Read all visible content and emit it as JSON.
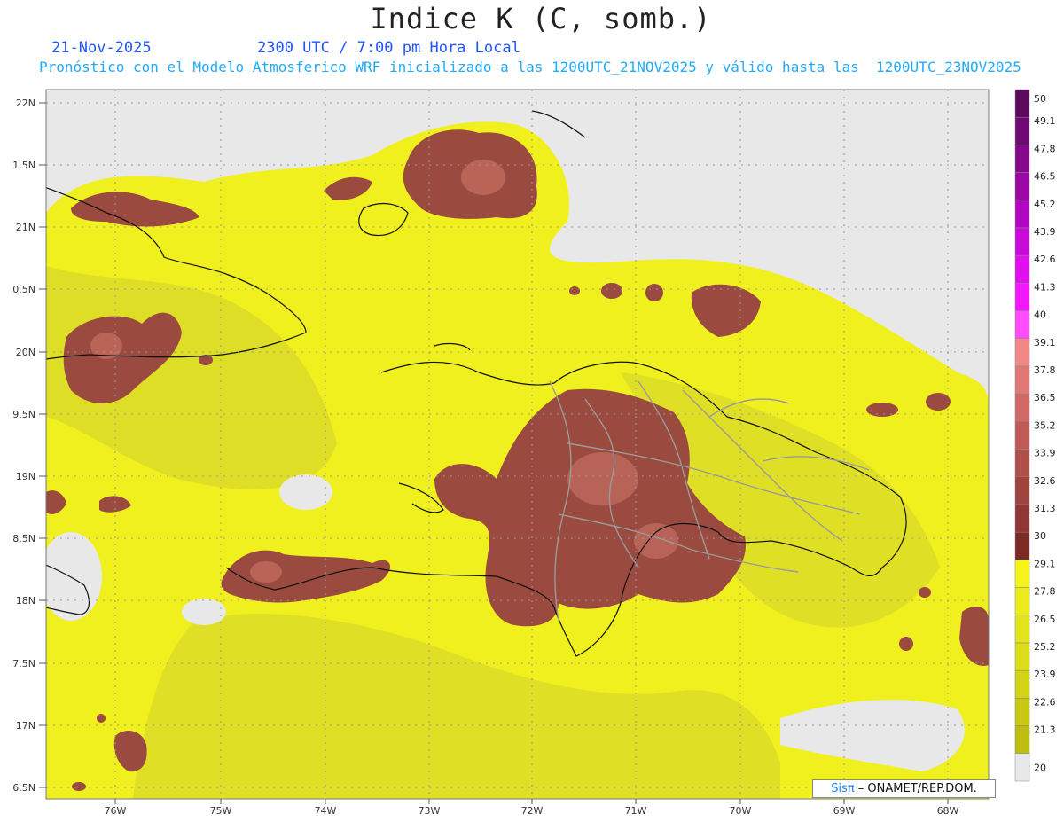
{
  "title": "Indice K (C, somb.)",
  "date": "21-Nov-2025",
  "time": "2300 UTC / 7:00 pm Hora Local",
  "forecast": "Pronóstico con el Modelo Atmosferico WRF inicializado a las 1200UTC_21NOV2025 y válido hasta las  1200UTC_23NOV2025",
  "lat_labels": [
    "22N",
    "1.5N",
    "21N",
    "0.5N",
    "20N",
    "9.5N",
    "19N",
    "8.5N",
    "18N",
    "7.5N",
    "17N",
    "6.5N"
  ],
  "lon_labels": [
    "76W",
    "75W",
    "74W",
    "73W",
    "72W",
    "71W",
    "70W",
    "69W",
    "68W"
  ],
  "colorbar_labels": [
    "50",
    "49.1",
    "47.8",
    "46.5",
    "45.2",
    "43.9",
    "42.6",
    "41.3",
    "40",
    "39.1",
    "37.8",
    "36.5",
    "35.2",
    "33.9",
    "32.6",
    "31.3",
    "30",
    "29.1",
    "27.8",
    "26.5",
    "25.2",
    "23.9",
    "22.6",
    "21.3",
    "20"
  ],
  "colorbar_colors": [
    "#5c0a5c",
    "#6e0a72",
    "#84088a",
    "#9a08a6",
    "#b008c0",
    "#c80cd8",
    "#e010ec",
    "#f018f8",
    "#ff4cff",
    "#f08888",
    "#e07878",
    "#d06868",
    "#c05a58",
    "#b04e4a",
    "#a0423e",
    "#903634",
    "#7c2a24",
    "#f4f41a",
    "#ecec1c",
    "#e4e41a",
    "#dcdc18",
    "#d2d216",
    "#c8c814",
    "#bebe12",
    "#e8e8e8"
  ],
  "credit_brand": "Sisπ",
  "credit_rest": " – ONAMET/REP.DOM.",
  "colors": {
    "land_background": "#e8e8e8",
    "field_yellow": "#f0f01e",
    "field_olive": "#dcdc28",
    "field_brown": "#9a4a3e",
    "field_brown_light": "#c06a5e",
    "title_color": "#222222",
    "date_color": "#2255ff",
    "forecast_color": "#22aaff"
  }
}
